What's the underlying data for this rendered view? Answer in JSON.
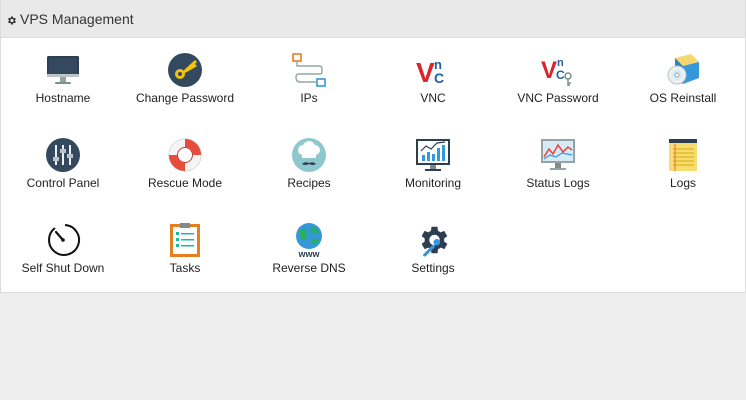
{
  "header": {
    "title": "VPS Management",
    "icon": "gear-icon"
  },
  "items": [
    {
      "label": "Hostname",
      "icon": "monitor-icon"
    },
    {
      "label": "Change Password",
      "icon": "key-icon"
    },
    {
      "label": "IPs",
      "icon": "network-ips-icon"
    },
    {
      "label": "VNC",
      "icon": "vnc-icon"
    },
    {
      "label": "VNC Password",
      "icon": "vnc-password-icon"
    },
    {
      "label": "OS Reinstall",
      "icon": "disc-install-icon"
    },
    {
      "label": "Control Panel",
      "icon": "control-panel-sliders-icon"
    },
    {
      "label": "Rescue Mode",
      "icon": "lifebuoy-icon"
    },
    {
      "label": "Recipes",
      "icon": "chef-hat-icon"
    },
    {
      "label": "Monitoring",
      "icon": "monitoring-chart-icon"
    },
    {
      "label": "Status Logs",
      "icon": "status-logs-chart-icon"
    },
    {
      "label": "Logs",
      "icon": "notepad-icon"
    },
    {
      "label": "Self Shut Down",
      "icon": "timer-gauge-icon"
    },
    {
      "label": "Tasks",
      "icon": "clipboard-tasks-icon"
    },
    {
      "label": "Reverse DNS",
      "icon": "globe-www-icon"
    },
    {
      "label": "Settings",
      "icon": "settings-gear-wrench-icon"
    }
  ],
  "colors": {
    "header_bg": "#e9e9e9",
    "panel_bg": "#ffffff",
    "page_bg": "#eeeeee",
    "vnc_red": "#d9252a",
    "vnc_blue": "#1f5fa8"
  }
}
